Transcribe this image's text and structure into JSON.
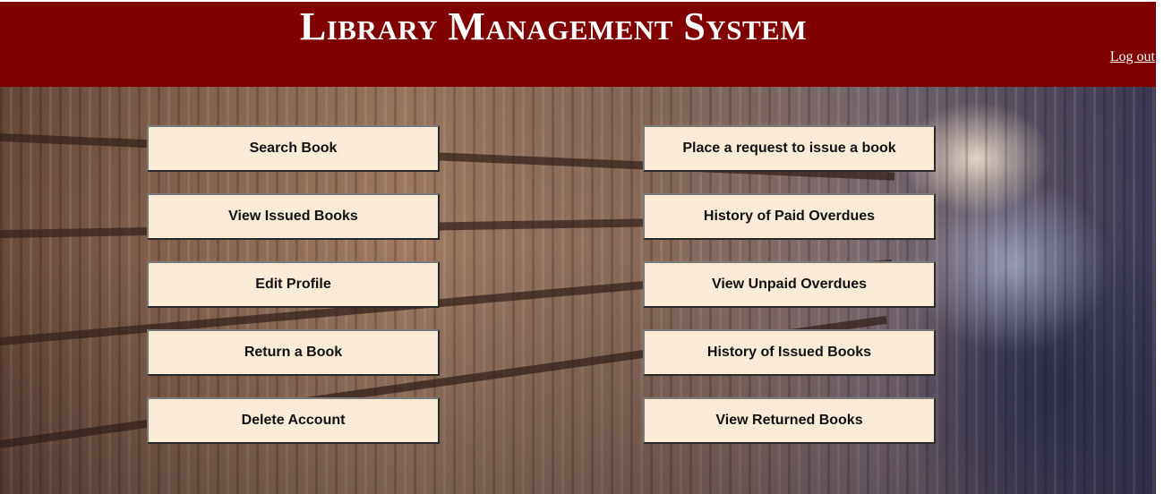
{
  "header": {
    "title": "Library Management System",
    "logout_label": "Log out"
  },
  "menu": {
    "left": [
      {
        "label": "Search Book"
      },
      {
        "label": "View Issued Books"
      },
      {
        "label": "Edit Profile"
      },
      {
        "label": "Return a Book"
      },
      {
        "label": "Delete Account"
      }
    ],
    "right": [
      {
        "label": "Place a request to issue a book"
      },
      {
        "label": "History of Paid Overdues"
      },
      {
        "label": "View Unpaid Overdues"
      },
      {
        "label": "History of Issued Books"
      },
      {
        "label": "View Returned Books"
      }
    ]
  },
  "colors": {
    "header_bg": "#800000",
    "button_bg": "#faebd7",
    "header_text": "#ffffff"
  }
}
